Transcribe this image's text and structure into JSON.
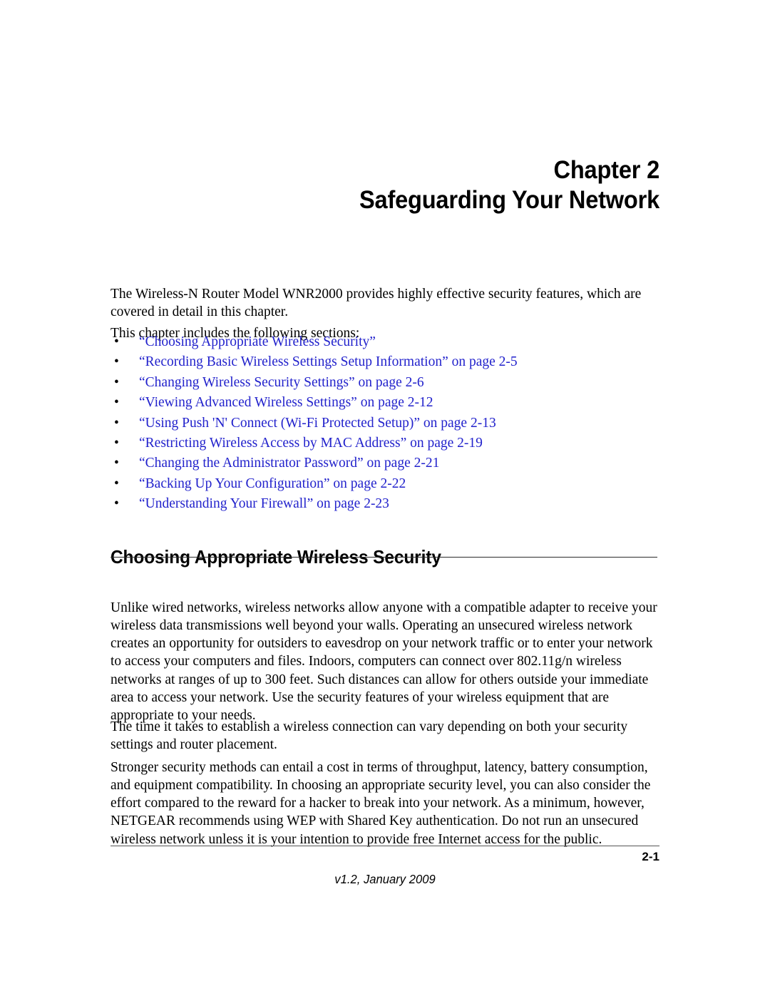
{
  "document": {
    "chapter_label": "Chapter 2",
    "chapter_title": "Safeguarding Your Network"
  },
  "intro": {
    "paragraph_1": "The Wireless-N Router Model WNR2000  provides highly effective security features, which are covered in detail in this chapter.",
    "paragraph_2": "This chapter includes the following sections:"
  },
  "bullet_glyph": "•",
  "section_links": [
    {
      "label": "“Choosing Appropriate Wireless Security”"
    },
    {
      "label": "“Recording Basic Wireless Settings Setup Information” on page 2-5"
    },
    {
      "label": "“Changing Wireless Security Settings” on page 2-6"
    },
    {
      "label": "“Viewing Advanced Wireless Settings” on page 2-12"
    },
    {
      "label": "“Using Push 'N' Connect (Wi-Fi Protected Setup)” on page 2-13"
    },
    {
      "label": "“Restricting Wireless Access by MAC Address” on page 2-19"
    },
    {
      "label": "“Changing the Administrator Password” on page 2-21"
    },
    {
      "label": "“Backing Up Your Configuration” on page 2-22"
    },
    {
      "label": "“Understanding Your Firewall” on page 2-23"
    }
  ],
  "section": {
    "heading": "Choosing Appropriate Wireless Security",
    "paragraph_1": "Unlike wired networks, wireless networks allow anyone with a compatible adapter to receive your wireless data transmissions well beyond your walls. Operating an unsecured wireless network creates an opportunity for outsiders to eavesdrop on your network traffic or to enter your network to access your computers and files. Indoors, computers can connect over 802.11g/n wireless networks at ranges of up to 300 feet. Such distances can allow for others outside your immediate area to access your network. Use the security features of your wireless equipment that are appropriate to your needs.",
    "paragraph_2": "The time it takes to establish a wireless connection can vary depending on both your security settings and router placement.",
    "paragraph_3": "Stronger security methods can entail a cost in terms of throughput, latency, battery consumption, and equipment compatibility. In choosing an appropriate security level, you can also consider the effort compared to the reward for a hacker to break into your network. As a minimum, however, NETGEAR recommends using WEP with Shared Key authentication. Do not run an unsecured wireless network unless it is your intention to provide free Internet access for the public."
  },
  "footer": {
    "page_number": "2-1",
    "version": "v1.2, January 2009"
  },
  "colors": {
    "link": "#2222cc",
    "text": "#000000",
    "rule": "#2b2b2b"
  }
}
